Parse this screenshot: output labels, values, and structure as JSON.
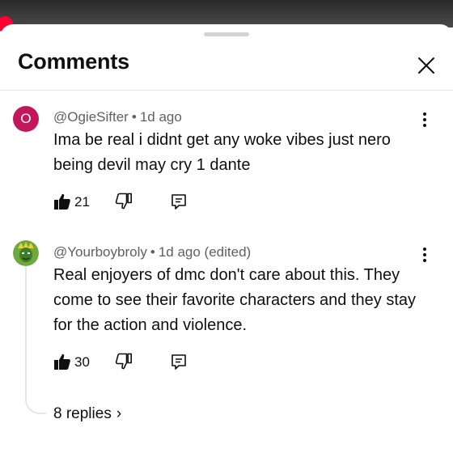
{
  "sheet": {
    "title": "Comments"
  },
  "comments": [
    {
      "avatar_letter": "O",
      "author": "@OgieSifter",
      "sep": "•",
      "time": "1d ago",
      "text": "Ima be real i didnt get any woke vibes just nero being devil may cry 1 dante",
      "likes": "21"
    },
    {
      "avatar_letter": "",
      "author": "@Yourboybroly",
      "sep": "•",
      "time": "1d ago (edited)",
      "text": "Real enjoyers of dmc don't care about this. They come to see their favorite characters and they stay for the action and violence.",
      "likes": "30",
      "replies": "8 replies"
    }
  ],
  "icons": {
    "close": "close-icon",
    "more": "more-vert-icon",
    "like": "thumbs-up-icon",
    "dislike": "thumbs-down-icon",
    "reply": "reply-icon",
    "chevron": "chevron-right-icon"
  },
  "colors": {
    "avatar_o": "#c2185b",
    "red_dot": "#ff0033",
    "meta_text": "#606060"
  }
}
